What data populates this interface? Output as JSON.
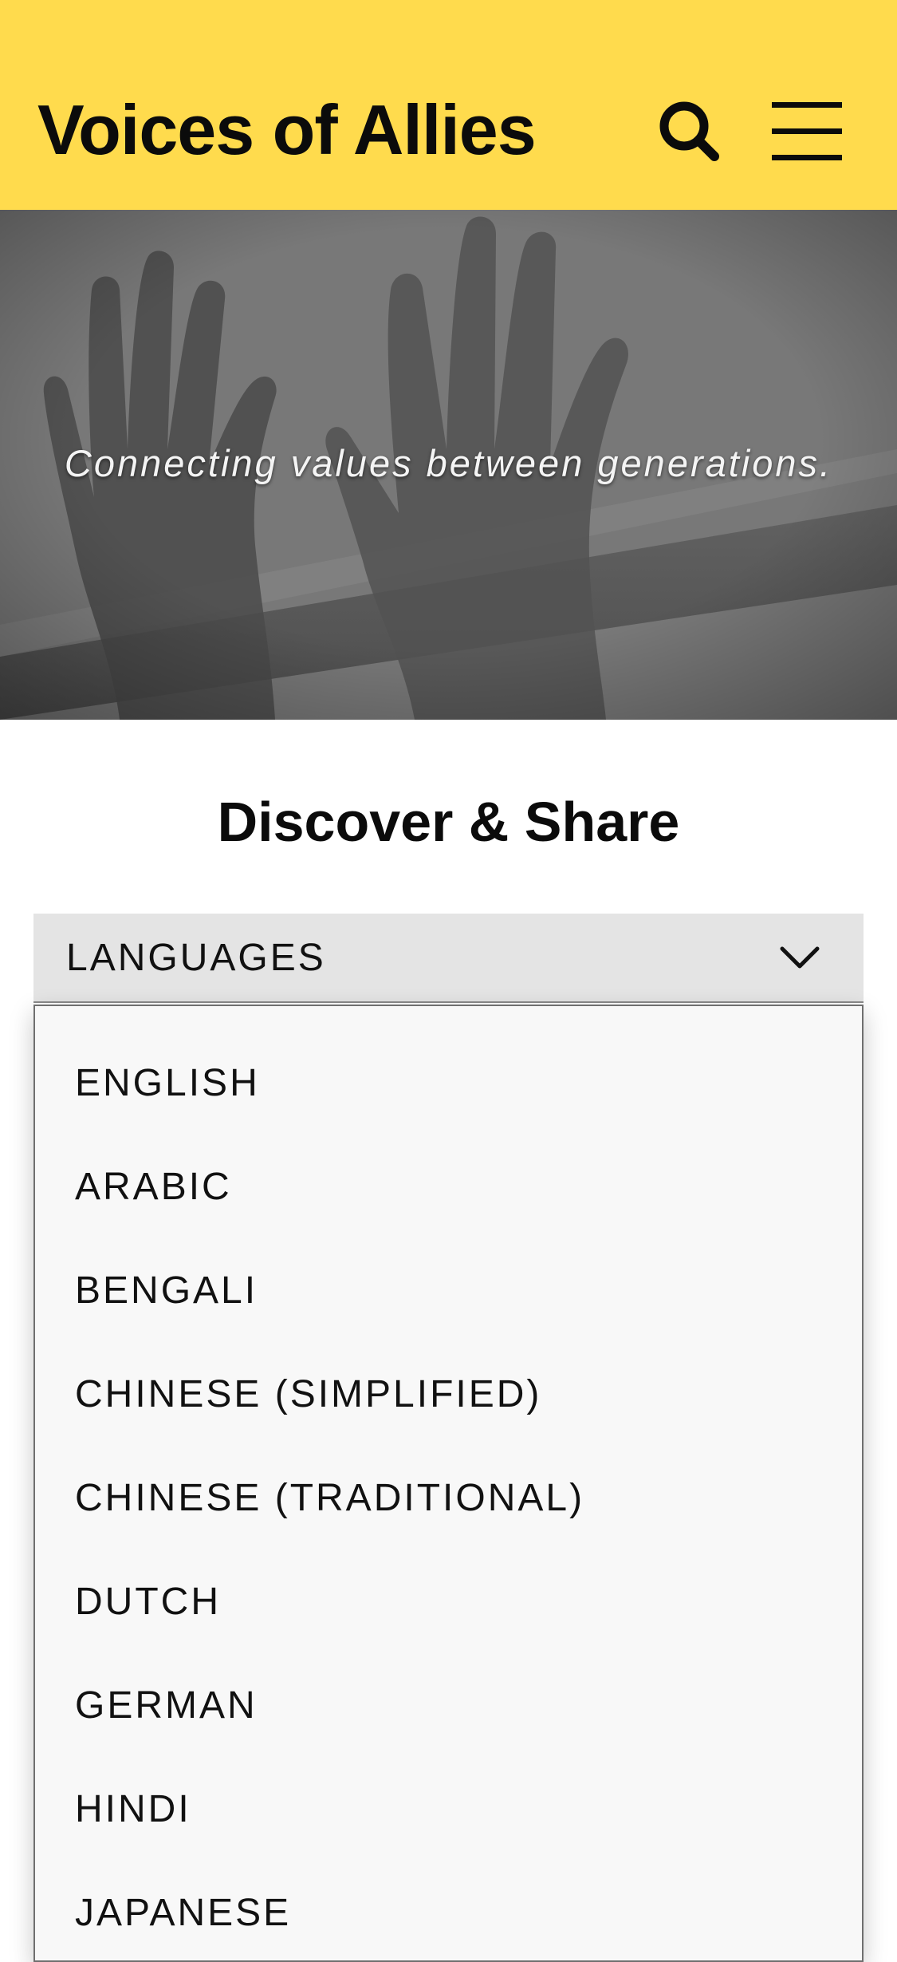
{
  "header": {
    "title": "Voices of Allies",
    "background_color": "#ffdb4d",
    "search_icon": "search-icon",
    "menu_icon": "hamburger-menu-icon"
  },
  "hero": {
    "tagline": "Connecting values between generations.",
    "image": "raised-hands-photo"
  },
  "main": {
    "heading": "Discover & Share",
    "language_select": {
      "label": "LANGUAGES",
      "icon": "chevron-down-icon",
      "options": [
        "ENGLISH",
        "ARABIC",
        "BENGALI",
        "CHINESE (SIMPLIFIED)",
        "CHINESE (TRADITIONAL)",
        "DUTCH",
        "GERMAN",
        "HINDI",
        "JAPANESE"
      ]
    }
  }
}
